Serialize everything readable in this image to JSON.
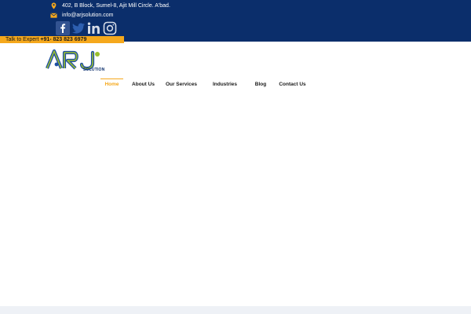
{
  "contact": {
    "address": "402, B Block, Sumel-8, Ajit Mill Circle. A'bad.",
    "email": "info@arjsolution.com"
  },
  "socials": [
    {
      "icon": "facebook-icon"
    },
    {
      "icon": "twitter-icon"
    },
    {
      "icon": "linkedin-icon"
    },
    {
      "icon": "instagram-icon"
    }
  ],
  "expert": {
    "label": "Talk to Expert",
    "phone": "+91- 823 823 6979"
  },
  "brand": {
    "logo_letters": "ARJ",
    "logo_subtitle": "SOLUTION"
  },
  "nav": {
    "items": [
      {
        "label": "Home",
        "active": true
      },
      {
        "label": "About Us"
      },
      {
        "label": "Our Services"
      },
      {
        "label": "Industries"
      },
      {
        "label": "Blog"
      },
      {
        "label": "Contact Us"
      }
    ]
  },
  "colors": {
    "topbar": "#0b2e6b",
    "accent": "#f5a81c",
    "logo_green": "#9bbf2d",
    "logo_blue": "#1f4fa3"
  }
}
